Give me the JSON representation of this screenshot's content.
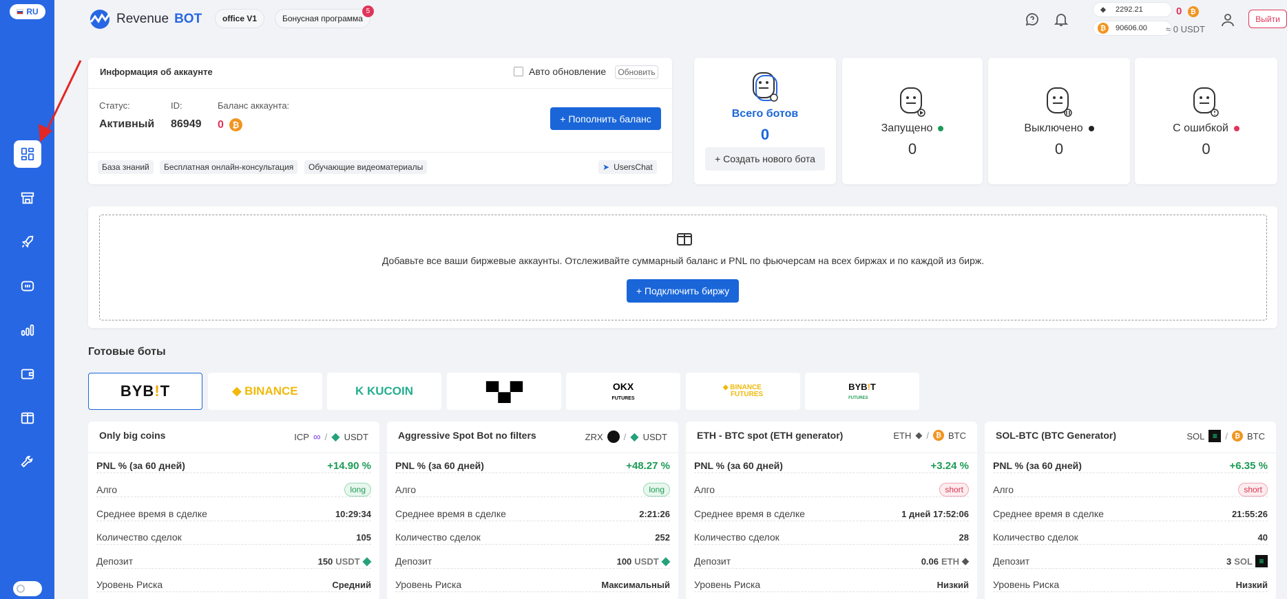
{
  "language": "RU",
  "sidebar": {
    "items": [
      {
        "icon": "dashboard-icon",
        "active": true
      },
      {
        "icon": "store-icon"
      },
      {
        "icon": "rocket-icon"
      },
      {
        "icon": "bot-chat-icon"
      },
      {
        "icon": "chart-bars-icon"
      },
      {
        "icon": "wallet-icon"
      },
      {
        "icon": "book-icon"
      },
      {
        "icon": "wrench-icon"
      }
    ]
  },
  "header": {
    "logo_text_1": "Revenue",
    "logo_text_2": "BOT",
    "office": "office V1",
    "bonus": "Бонусная программа",
    "bonus_badge": "5",
    "eth_rate": "2292.21",
    "btc_rate": "90606.00",
    "balance_count": "0",
    "usdt_total": "≈ 0 USDT",
    "exit": "Выйти"
  },
  "account": {
    "title": "Информация об аккаунте",
    "auto_update": "Авто обновление",
    "refresh": "Обновить",
    "status_label": "Статус:",
    "status_value": "Активный",
    "id_label": "ID:",
    "id_value": "86949",
    "balance_label": "Баланс аккаунта:",
    "balance_value": "0",
    "topup": "+ Пополнить баланс",
    "links": [
      "База знаний",
      "Бесплатная онлайн-консультация",
      "Обучающие видеоматериалы"
    ],
    "chat": "UsersChat"
  },
  "bots_summary": {
    "total_label": "Всего ботов",
    "total_value": "0",
    "create": "+ Создать нового бота",
    "stats": [
      {
        "label": "Запущено",
        "value": "0",
        "dot": "#1c9b55"
      },
      {
        "label": "Выключено",
        "value": "0",
        "dot": "#222222"
      },
      {
        "label": "С ошибкой",
        "value": "0",
        "dot": "#e0355a"
      }
    ]
  },
  "exchange_banner": {
    "text": "Добавьте все ваши биржевые аккаунты. Отслеживайте суммарный баланс и PNL по фьючерсам на всех биржах и по каждой из бирж.",
    "button": "+ Подключить биржу"
  },
  "ready_bots": {
    "title": "Готовые боты",
    "exchanges": [
      "BYBIT",
      "BINANCE",
      "KUCOIN",
      "OKX",
      "OKX FUTURES",
      "BINANCE FUTURES",
      "BYBIT FUTURES"
    ],
    "cards": [
      {
        "title": "Only big coins",
        "base": "ICP",
        "quote": "USDT",
        "pnl_label": "PNL % (за 60 дней)",
        "pnl": "+14.90 %",
        "algo_label": "Алго",
        "algo": "long",
        "avg_label": "Среднее время в сделке",
        "avg": "10:29:34",
        "count_label": "Количество сделок",
        "count": "105",
        "deposit_label": "Депозит",
        "deposit": "150",
        "deposit_cur": "USDT",
        "risk_label": "Уровень Риска",
        "risk": "Средний"
      },
      {
        "title": "Aggressive Spot Bot no filters",
        "base": "ZRX",
        "quote": "USDT",
        "pnl_label": "PNL % (за 60 дней)",
        "pnl": "+48.27 %",
        "algo_label": "Алго",
        "algo": "long",
        "avg_label": "Среднее время в сделке",
        "avg": "2:21:26",
        "count_label": "Количество сделок",
        "count": "252",
        "deposit_label": "Депозит",
        "deposit": "100",
        "deposit_cur": "USDT",
        "risk_label": "Уровень Риска",
        "risk": "Максимальный"
      },
      {
        "title": "ETH - BTC spot (ETH generator)",
        "base": "ETH",
        "quote": "BTC",
        "pnl_label": "PNL % (за 60 дней)",
        "pnl": "+3.24 %",
        "algo_label": "Алго",
        "algo": "short",
        "avg_label": "Среднее время в сделке",
        "avg": "1 дней 17:52:06",
        "count_label": "Количество сделок",
        "count": "28",
        "deposit_label": "Депозит",
        "deposit": "0.06",
        "deposit_cur": "ETH",
        "risk_label": "Уровень Риска",
        "risk": "Низкий"
      },
      {
        "title": "SOL-BTC (BTC Generator)",
        "base": "SOL",
        "quote": "BTC",
        "pnl_label": "PNL % (за 60 дней)",
        "pnl": "+6.35 %",
        "algo_label": "Алго",
        "algo": "short",
        "avg_label": "Среднее время в сделке",
        "avg": "21:55:26",
        "count_label": "Количество сделок",
        "count": "40",
        "deposit_label": "Депозит",
        "deposit": "3",
        "deposit_cur": "SOL",
        "risk_label": "Уровень Риска",
        "risk": "Низкий"
      }
    ]
  }
}
